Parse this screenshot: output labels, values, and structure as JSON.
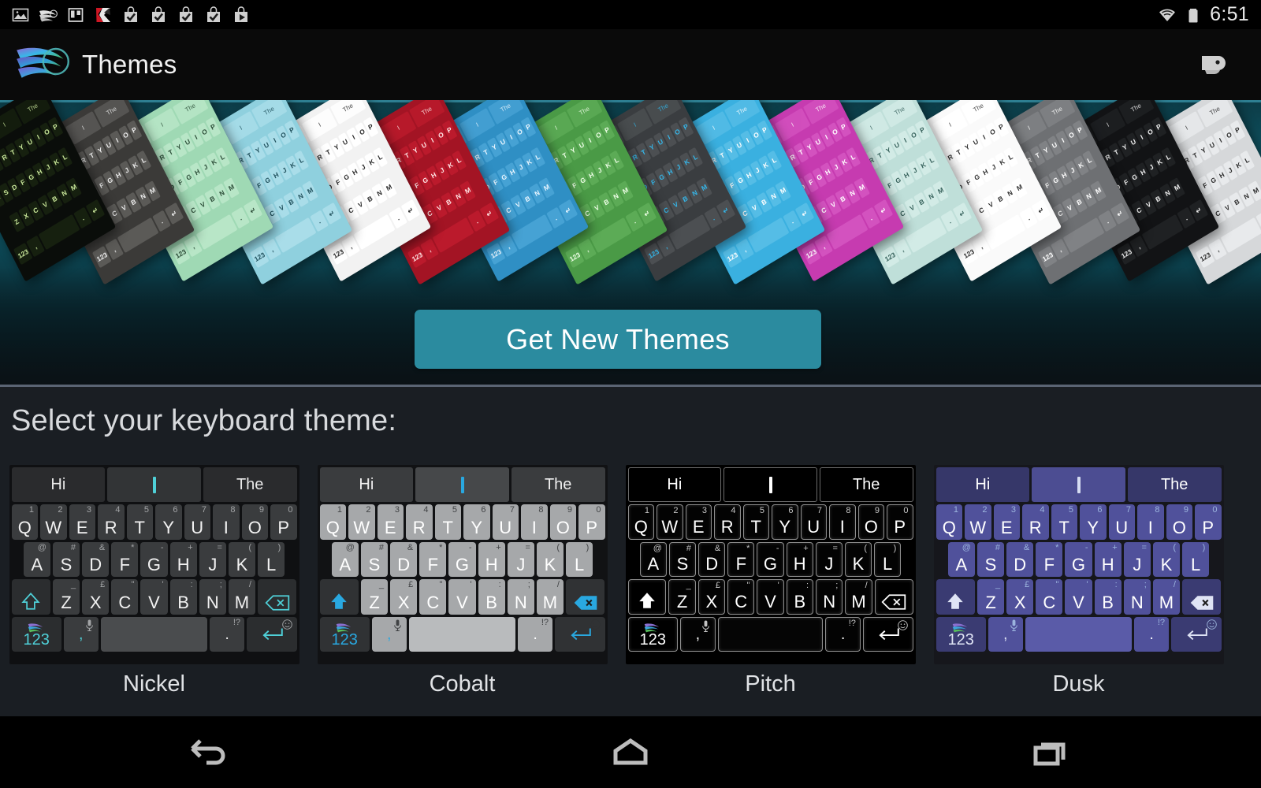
{
  "status_bar": {
    "time": "6:51",
    "left_icons": [
      {
        "name": "image-icon"
      },
      {
        "name": "swiftkey-icon"
      },
      {
        "name": "trello-icon"
      },
      {
        "name": "kaspersky-icon"
      },
      {
        "name": "app-install-icon-1"
      },
      {
        "name": "app-install-icon-2"
      },
      {
        "name": "app-install-icon-3"
      },
      {
        "name": "app-install-icon-4"
      },
      {
        "name": "play-install-icon"
      }
    ],
    "right_icons": [
      {
        "name": "wifi-icon"
      },
      {
        "name": "battery-icon"
      }
    ]
  },
  "action_bar": {
    "title": "Themes",
    "logo": "swiftkey-logo",
    "action_icon": "tag-icon"
  },
  "banner": {
    "carousel_cards": [
      {
        "name": "theme-preview-black-green",
        "bg": "#0a0d0a",
        "key": "#16200f",
        "text": "#c9e79a"
      },
      {
        "name": "theme-preview-dark-gray",
        "bg": "#3b3a38",
        "key": "#5b5a57",
        "text": "#ededed"
      },
      {
        "name": "theme-preview-mint",
        "bg": "#9fd9b4",
        "key": "#b8e6c7",
        "text": "#2c4d38"
      },
      {
        "name": "theme-preview-sky",
        "bg": "#8fd0de",
        "key": "#a9dde9",
        "text": "#20505c"
      },
      {
        "name": "theme-preview-white",
        "bg": "#f2f2f2",
        "key": "#ffffff",
        "text": "#2a2a2a"
      },
      {
        "name": "theme-preview-red",
        "bg": "#a31424",
        "key": "#bb1a2c",
        "text": "#ffe7e7"
      },
      {
        "name": "theme-preview-ocean",
        "bg": "#2f8fc4",
        "key": "#46a2d4",
        "text": "#eaf6ff"
      },
      {
        "name": "theme-preview-green",
        "bg": "#4a9a46",
        "key": "#5cab56",
        "text": "#f0ffe9"
      },
      {
        "name": "theme-preview-charcoal",
        "bg": "#3a3d40",
        "key": "#4c4f52",
        "text": "#35b7ea"
      },
      {
        "name": "theme-preview-blue",
        "bg": "#3ab0e0",
        "key": "#55bde6",
        "text": "#ffffff"
      },
      {
        "name": "theme-preview-magenta",
        "bg": "#c63bb0",
        "key": "#d352bf",
        "text": "#ffffff"
      },
      {
        "name": "theme-preview-pale-mint",
        "bg": "#bfdfd9",
        "key": "#d2ebe6",
        "text": "#37625c"
      },
      {
        "name": "theme-preview-light",
        "bg": "#fafafa",
        "key": "#ffffff",
        "text": "#303030"
      },
      {
        "name": "theme-preview-gray",
        "bg": "#6e7073",
        "key": "#808285",
        "text": "#ffffff"
      },
      {
        "name": "theme-preview-dark",
        "bg": "#121315",
        "key": "#1f2123",
        "text": "#f0f0f0"
      },
      {
        "name": "theme-preview-silver",
        "bg": "#d6d8da",
        "key": "#e8eaec",
        "text": "#2b2b2b"
      }
    ],
    "preview_labels": {
      "left": "Hi",
      "middle": "I",
      "right": "The"
    },
    "preview_rows": [
      "QWERTYUIOP",
      "ASDFGHJKL",
      "ZXCVBNM"
    ],
    "accent_color": "#2b8b9f"
  },
  "get_new_themes_button": {
    "label": "Get New Themes",
    "color": "#2b8b9f"
  },
  "select_section": {
    "heading": "Select your keyboard theme:"
  },
  "keyboard_preview": {
    "predictions": {
      "left": "Hi",
      "middle": "I",
      "right": "The"
    },
    "row1": [
      {
        "key": "Q",
        "sup": "1"
      },
      {
        "key": "W",
        "sup": "2"
      },
      {
        "key": "E",
        "sup": "3"
      },
      {
        "key": "R",
        "sup": "4"
      },
      {
        "key": "T",
        "sup": "5"
      },
      {
        "key": "Y",
        "sup": "6"
      },
      {
        "key": "U",
        "sup": "7"
      },
      {
        "key": "I",
        "sup": "8"
      },
      {
        "key": "O",
        "sup": "9"
      },
      {
        "key": "P",
        "sup": "0"
      }
    ],
    "row2": [
      {
        "key": "A",
        "sup": "@"
      },
      {
        "key": "S",
        "sup": "#"
      },
      {
        "key": "D",
        "sup": "&"
      },
      {
        "key": "F",
        "sup": "*"
      },
      {
        "key": "G",
        "sup": "-"
      },
      {
        "key": "H",
        "sup": "+"
      },
      {
        "key": "J",
        "sup": "="
      },
      {
        "key": "K",
        "sup": "("
      },
      {
        "key": "L",
        "sup": ")"
      }
    ],
    "row3": [
      {
        "key": "Z",
        "sup": "_"
      },
      {
        "key": "X",
        "sup": "£"
      },
      {
        "key": "C",
        "sup": "\""
      },
      {
        "key": "V",
        "sup": "'"
      },
      {
        "key": "B",
        "sup": ":"
      },
      {
        "key": "N",
        "sup": ";"
      },
      {
        "key": "M",
        "sup": "/"
      }
    ],
    "shift_key": "shift-arrow-icon",
    "backspace_key": "backspace-icon",
    "numeric_key": "123",
    "comma_key": ",",
    "mic_key": "microphone-icon",
    "period_key": ".",
    "punct_sup": "!?",
    "emoji_key": "emoji-icon",
    "enter_key": "enter-icon",
    "swiftkey_key": "swiftkey-icon"
  },
  "themes": [
    {
      "id": "nickel",
      "label": "Nickel",
      "class": "t-nickel",
      "bg": "#0f1012",
      "key_color": "#3a3c3e",
      "text_color": "#f2f2f2",
      "accent": "#4fd0d8"
    },
    {
      "id": "cobalt",
      "label": "Cobalt",
      "class": "t-cobalt",
      "bg": "#111214",
      "key_color": "#a6a8aa",
      "text_color": "#ffffff",
      "accent": "#29a8e0"
    },
    {
      "id": "pitch",
      "label": "Pitch",
      "class": "t-pitch",
      "bg": "#000000",
      "key_color": "#030303",
      "text_color": "#ffffff",
      "accent": "#ffffff"
    },
    {
      "id": "dusk",
      "label": "Dusk",
      "class": "t-dusk",
      "bg": "#16171c",
      "key_color": "#50519b",
      "text_color": "#ffffff",
      "accent": "#cfd6ea"
    }
  ],
  "nav_bar": {
    "back": "back-icon",
    "home": "home-icon",
    "recents": "recents-icon"
  }
}
